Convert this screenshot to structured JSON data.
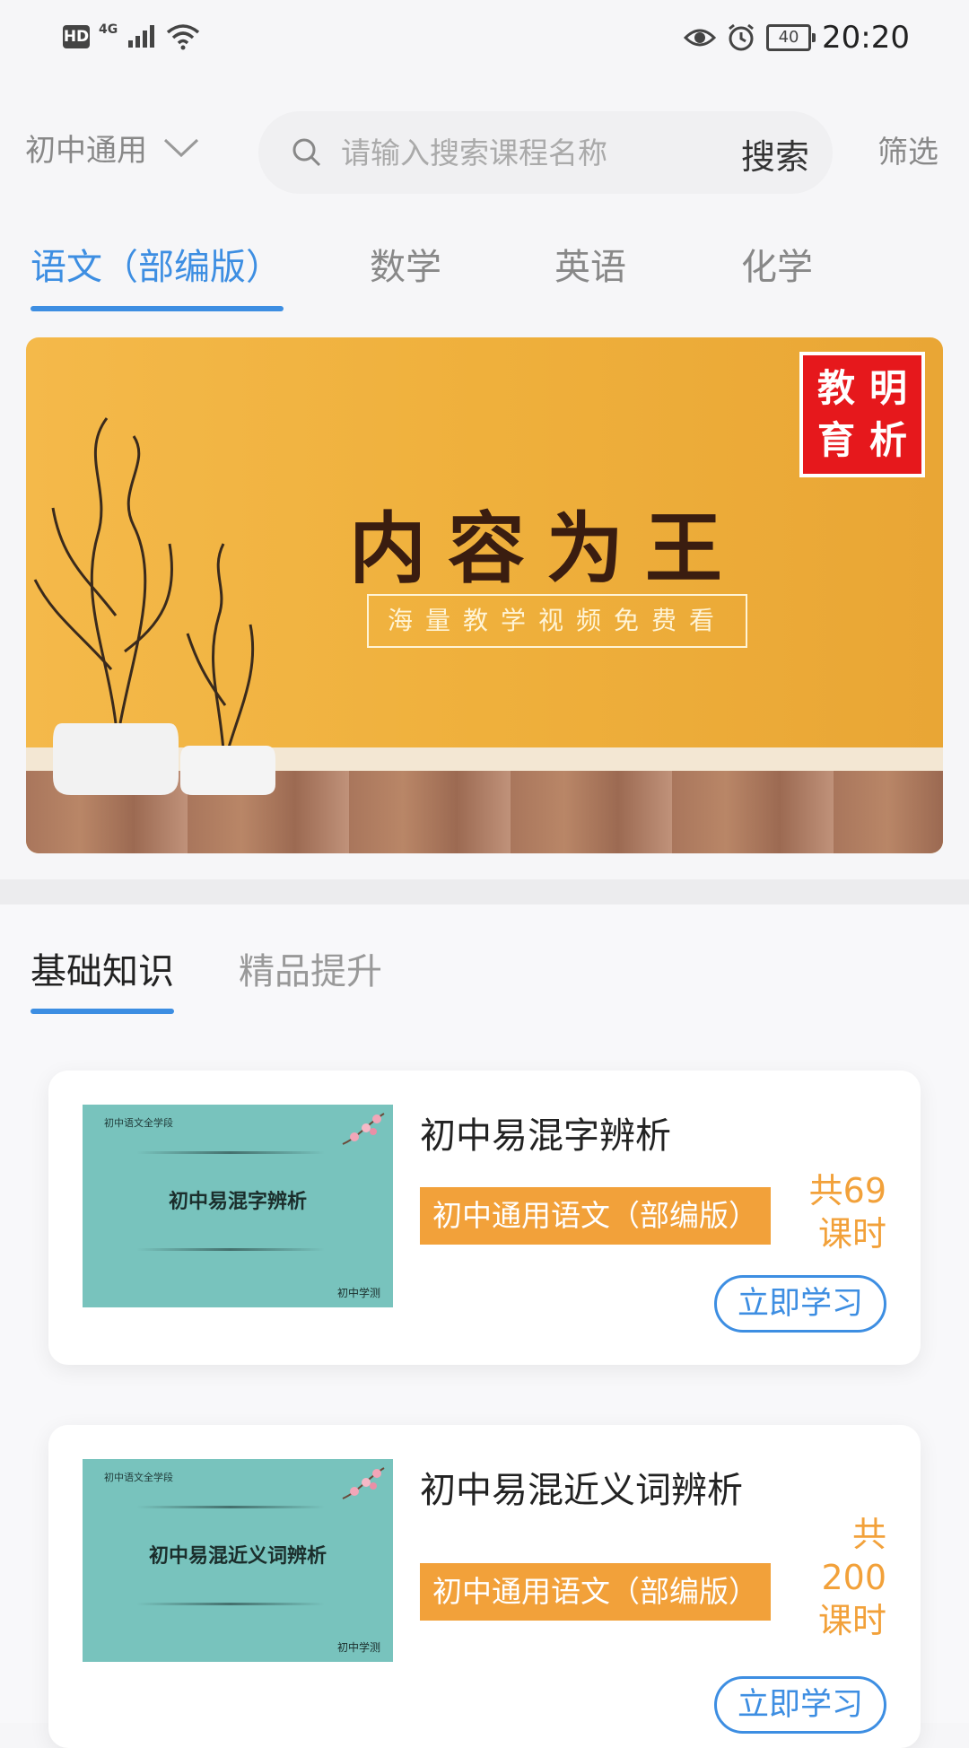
{
  "status_bar": {
    "left_badge": "HD",
    "network": "4G",
    "battery": "40",
    "time": "20:20"
  },
  "toolbar": {
    "grade_label": "初中通用",
    "search_placeholder": "请输入搜索课程名称",
    "search_button": "搜索",
    "filter_button": "筛选"
  },
  "subject_tabs": [
    {
      "label": "语文（部编版）",
      "active": true
    },
    {
      "label": "数学",
      "active": false
    },
    {
      "label": "英语",
      "active": false
    },
    {
      "label": "化学",
      "active": false
    }
  ],
  "banner": {
    "title": "内容为王",
    "subtitle": "海量教学视频免费看",
    "seal": [
      "教",
      "明",
      "育",
      "析"
    ]
  },
  "category_tabs": [
    {
      "label": "基础知识",
      "active": true
    },
    {
      "label": "精品提升",
      "active": false
    }
  ],
  "courses": [
    {
      "thumb_tag": "初中语文全学段",
      "thumb_title": "初中易混字辨析",
      "thumb_footer": "初中学测",
      "title": "初中易混字辨析",
      "tag": "初中通用语文（部编版）",
      "hours_line1": "共69",
      "hours_line2": "课时",
      "button": "立即学习"
    },
    {
      "thumb_tag": "初中语文全学段",
      "thumb_title": "初中易混近义词辨析",
      "thumb_footer": "初中学测",
      "title": "初中易混近义词辨析",
      "tag": "初中通用语文（部编版）",
      "hours_line1": "共",
      "hours_line2": "200",
      "hours_line3": "课时",
      "button": "立即学习"
    }
  ],
  "colors": {
    "accent_blue": "#3d8ee2",
    "tag_orange": "#f2a13a",
    "seal_red": "#e6181c"
  }
}
